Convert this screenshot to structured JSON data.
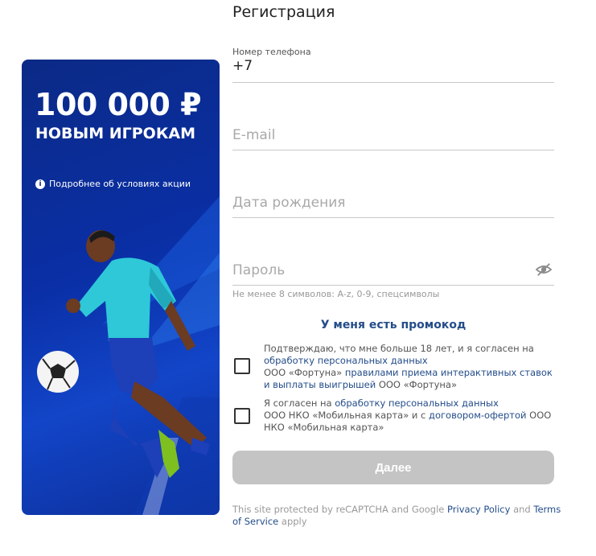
{
  "page": {
    "title": "Регистрация"
  },
  "banner": {
    "amount": "100 000 ₽",
    "subtitle": "НОВЫМ ИГРОКАМ",
    "info_link": "Подробнее об условиях акции",
    "colors": {
      "background": "#0b2a86",
      "accent": "#2ec8d8",
      "shorts": "#1d3fb8"
    }
  },
  "form": {
    "phone": {
      "label": "Номер телефона",
      "value": "+7"
    },
    "email": {
      "placeholder": "E-mail"
    },
    "birthdate": {
      "placeholder": "Дата рождения"
    },
    "password": {
      "placeholder": "Пароль",
      "hint": "Не менее 8 символов: A-z, 0-9, спецсимволы",
      "toggle_icon": "eye-slash-icon"
    },
    "promo_link": "У меня есть промокод",
    "consent1": {
      "t1": "Подтверждаю, что мне больше 18 лет, и я согласен на ",
      "link1": "обработку персональных данных",
      "t2": "ООО «Фортуна» ",
      "link2": "правилами приема интерактивных ставок и выплаты выигрышей",
      "t3": " ООО «Фортуна»"
    },
    "consent2": {
      "t1": "Я согласен на ",
      "link1": "обработку персональных данных",
      "t2": "ООО НКО «Мобильная карта» и с ",
      "link2": "договором-офертой",
      "t3": " ООО НКО «Мобильная карта»"
    },
    "submit_label": "Далее",
    "captcha": {
      "t1": "This site protected by reCAPTCHA and Google ",
      "privacy": "Privacy Policy",
      "t2": " and ",
      "terms": "Terms of Service",
      "t3": " apply"
    }
  }
}
